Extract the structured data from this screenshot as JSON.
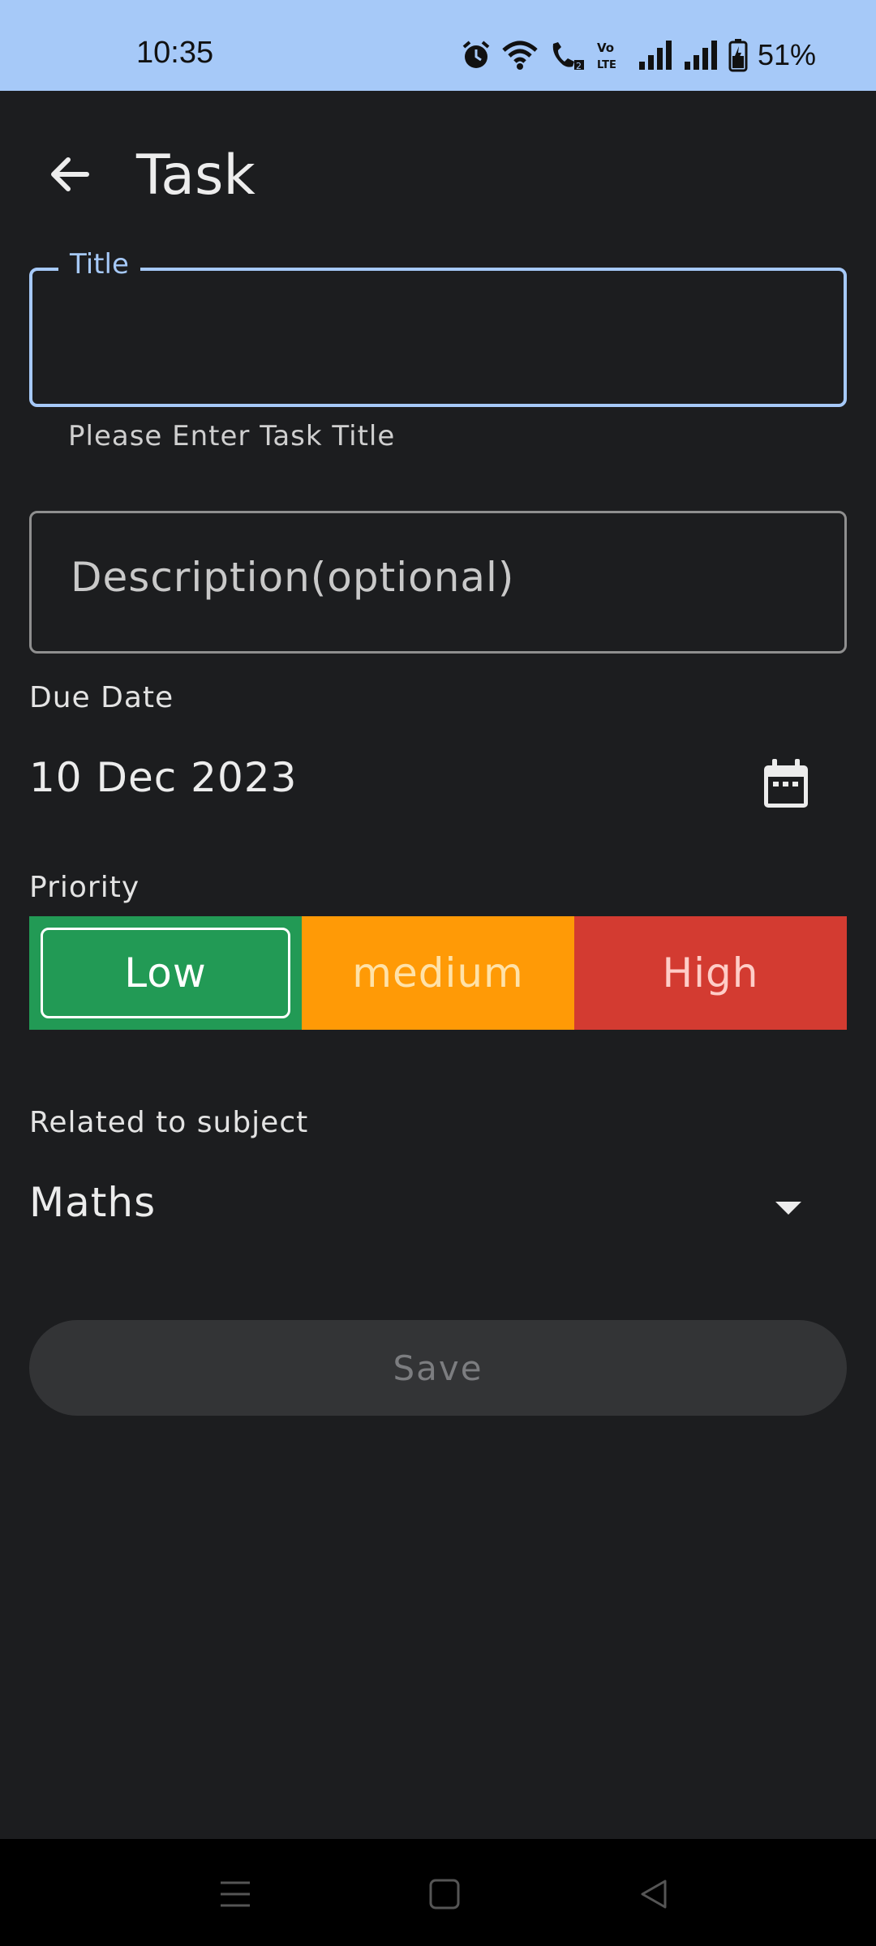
{
  "status_bar": {
    "time": "10:35",
    "battery": "51%",
    "icons": [
      "alarm-icon",
      "wifi-icon",
      "wifi-call-icon",
      "volte-icon",
      "signal-icon",
      "signal-icon",
      "battery-charging-icon"
    ]
  },
  "app_bar": {
    "title": "Task",
    "back_icon": "arrow-left-icon"
  },
  "form": {
    "title_field": {
      "label": "Title",
      "value": "",
      "helper": "Please Enter Task Title"
    },
    "description_field": {
      "placeholder": "Description(optional)",
      "value": ""
    },
    "due_date": {
      "label": "Due Date",
      "value": "10 Dec 2023",
      "icon": "calendar-icon"
    },
    "priority": {
      "label": "Priority",
      "options": [
        {
          "label": "Low",
          "color": "#229a55",
          "selected": true
        },
        {
          "label": "medium",
          "color": "#ff9a06",
          "selected": false
        },
        {
          "label": "High",
          "color": "#d33b31",
          "selected": false
        }
      ]
    },
    "subject": {
      "label": "Related to subject",
      "value": "Maths",
      "icon": "caret-down-icon"
    },
    "save_label": "Save"
  },
  "nav_bar": {
    "icons": [
      "menu-icon",
      "home-icon",
      "back-icon"
    ]
  },
  "colors": {
    "accent": "#a6c9f8",
    "background": "#1c1d1f"
  }
}
